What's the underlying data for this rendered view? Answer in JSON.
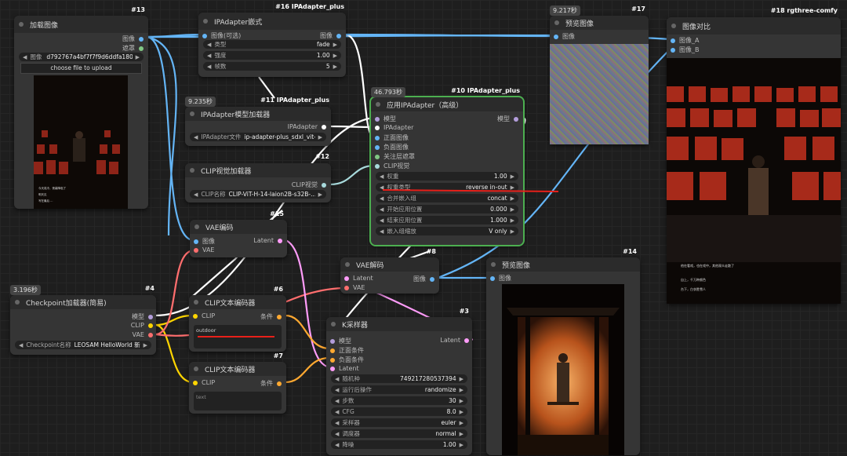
{
  "colors": {
    "image": "#64b5f6",
    "model": "#b39ddb",
    "clip": "#ffd500",
    "vae": "#ff6e6e",
    "latent": "#ff9cf9",
    "ipadapter": "#fff",
    "clipvision": "#a8dadc",
    "cond": "#ffa931",
    "accent": "#4caf50"
  },
  "nodes": {
    "load_image": {
      "id": "#13",
      "title": "加载图像",
      "out_image": "图像",
      "out_mask": "遮罩",
      "image_label": "图像",
      "image_value": "d792767a4bf7f7f9d6ddfa180...",
      "upload": "choose file to upload",
      "caption_lines": [
        "今天真冷，夜幕降临了",
        "明天见",
        "写在最后 ..."
      ]
    },
    "ipa_batch": {
      "id": "#16 IPAdapter_plus",
      "title": "IPAdapter嵌式",
      "in_image": "图像(可选)",
      "out_image": "图像",
      "w1_lab": "类型",
      "w1_val": "fade",
      "w2_lab": "强度",
      "w2_val": "1.00",
      "w3_lab": "帧数",
      "w3_val": "5"
    },
    "ipa_loader": {
      "id": "#11 IPAdapter_plus",
      "timer": "9.235秒",
      "title": "IPAdapter模型加载器",
      "out": "IPAdapter",
      "w_lab": "IPAdapter文件",
      "w_val": "ip-adapter-plus_sdxl_vit-h"
    },
    "clip_vision": {
      "id": "#12",
      "title": "CLIP视觉加载器",
      "out": "CLIP视觉",
      "w_lab": "CLIP名称",
      "w_val": "CLIP-ViT-H-14-laion2B-s32B-..."
    },
    "apply_ipa": {
      "id": "#10 IPAdapter_plus",
      "timer": "46.793秒",
      "title": "应用IPAdapter（高级）",
      "out": "模型",
      "inputs": [
        "模型",
        "IPAdapter",
        "正面图像",
        "负面图像",
        "关注层遮罩",
        "CLIP视觉"
      ],
      "widgets": [
        {
          "lab": "权重",
          "val": "1.00"
        },
        {
          "lab": "权重类型",
          "val": "reverse in-out"
        },
        {
          "lab": "合并嵌入组",
          "val": "concat"
        },
        {
          "lab": "开始应用位置",
          "val": "0.000"
        },
        {
          "lab": "结束应用位置",
          "val": "1.000"
        },
        {
          "lab": "嵌入组缩放",
          "val": "V only"
        }
      ]
    },
    "preview17": {
      "id": "#17",
      "timer": "9.217秒",
      "title": "预览图像",
      "in": "图像"
    },
    "compare": {
      "id": "#18 rgthree-comfy",
      "title": "图像对比",
      "in_a": "图像_A",
      "in_b": "图像_B",
      "caption_lines": [
        "他在看戏，也在戏中，其他观众走散了",
        "自上，千万种颜色",
        "台下，白衣胜雪人"
      ]
    },
    "vae_encode": {
      "id": "#15",
      "title": "VAE编码",
      "in_image": "图像",
      "in_vae": "VAE",
      "out": "Latent"
    },
    "checkpoint": {
      "id": "#4",
      "timer": "3.196秒",
      "title": "Checkpoint加载器(简易)",
      "out_model": "模型",
      "out_clip": "CLIP",
      "out_vae": "VAE",
      "w_lab": "Checkpoint名称",
      "w_val": "LEOSAM HelloWorld 新..."
    },
    "clip_pos": {
      "id": "#6",
      "title": "CLIP文本编码器",
      "in": "CLIP",
      "out": "条件",
      "text": "outdoor"
    },
    "clip_neg": {
      "id": "#7",
      "title": "CLIP文本编码器",
      "in": "CLIP",
      "out": "条件",
      "text": "text"
    },
    "vae_decode": {
      "id": "#8",
      "title": "VAE解码",
      "in_latent": "Latent",
      "in_vae": "VAE",
      "out": "图像"
    },
    "preview14": {
      "id": "#14",
      "title": "预览图像",
      "in": "图像"
    },
    "ksampler": {
      "id": "#3",
      "title": "K采样器",
      "inputs": [
        "模型",
        "正面条件",
        "负面条件",
        "Latent"
      ],
      "out": "Latent",
      "widgets": [
        {
          "lab": "随机种",
          "val": "749217280537394"
        },
        {
          "lab": "运行后操作",
          "val": "randomize"
        },
        {
          "lab": "步数",
          "val": "30"
        },
        {
          "lab": "CFG",
          "val": "8.0"
        },
        {
          "lab": "采样器",
          "val": "euler"
        },
        {
          "lab": "调度器",
          "val": "normal"
        },
        {
          "lab": "降噪",
          "val": "1.00"
        }
      ]
    }
  }
}
